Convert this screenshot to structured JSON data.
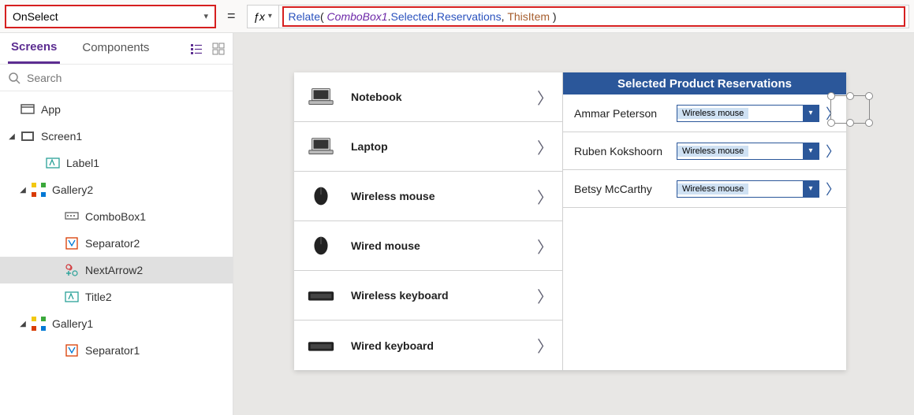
{
  "property": "OnSelect",
  "formula": {
    "fn": "Relate",
    "obj": "ComboBox1",
    "prop1": "Selected",
    "prop2": "Reservations",
    "arg2": "ThisItem",
    "open": "( ",
    "dot": ".",
    "comma": ", ",
    "close": " )"
  },
  "tabs": {
    "screens": "Screens",
    "components": "Components"
  },
  "search": {
    "placeholder": "Search"
  },
  "tree": {
    "app": "App",
    "screen1": "Screen1",
    "label1": "Label1",
    "gallery2": "Gallery2",
    "combobox1": "ComboBox1",
    "separator2": "Separator2",
    "nextarrow2": "NextArrow2",
    "title2": "Title2",
    "gallery1": "Gallery1",
    "separator1": "Separator1"
  },
  "products": [
    {
      "name": "Notebook",
      "img": "laptop"
    },
    {
      "name": "Laptop",
      "img": "laptop"
    },
    {
      "name": "Wireless mouse",
      "img": "mouse"
    },
    {
      "name": "Wired mouse",
      "img": "mouse"
    },
    {
      "name": "Wireless keyboard",
      "img": "keyboard"
    },
    {
      "name": "Wired keyboard",
      "img": "keyboard"
    }
  ],
  "rightHeader": "Selected Product Reservations",
  "reservations": [
    {
      "name": "Ammar Peterson",
      "combo": "Wireless mouse"
    },
    {
      "name": "Ruben Kokshoorn",
      "combo": "Wireless mouse"
    },
    {
      "name": "Betsy McCarthy",
      "combo": "Wireless mouse"
    }
  ]
}
